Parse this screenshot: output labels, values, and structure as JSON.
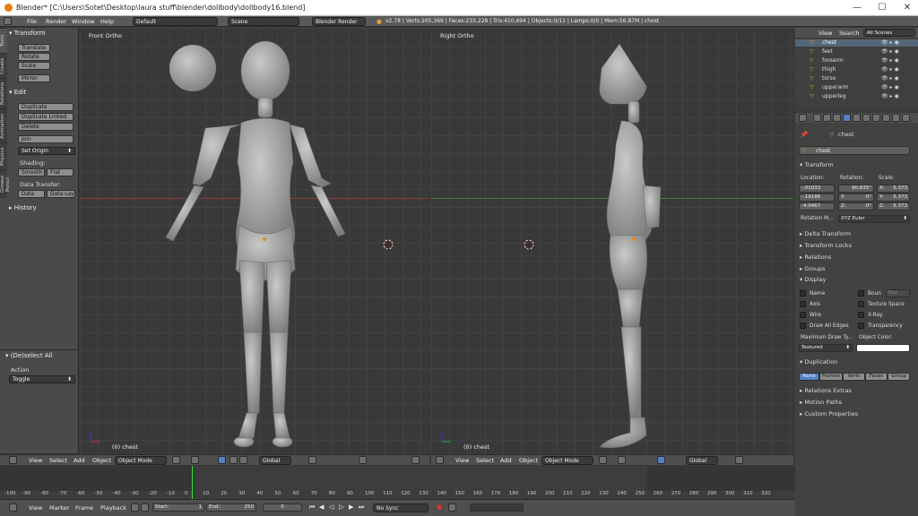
{
  "titlebar": {
    "title": "Blender* [C:\\Users\\Sotet\\Desktop\\laura stuff\\blender\\dollbody\\dollbody16.blend]",
    "min": "—",
    "max": "☐",
    "close": "✕"
  },
  "info": {
    "menus": [
      "File",
      "Render",
      "Window",
      "Help"
    ],
    "layout": "Default",
    "scene": "Scene",
    "engine": "Blender Render",
    "stats": "v2.78 | Verts:205,369 | Faces:233,228 | Tris:410,694 | Objects:0/11 | Lamps:0/0 | Mem:56.87M | chest"
  },
  "toolshelf": {
    "tabs": [
      "Tools",
      "Create",
      "Relations",
      "Animation",
      "Physics",
      "Grease Pencil"
    ],
    "transform_header": "Transform",
    "transform_buttons": [
      "Translate",
      "Rotate",
      "Scale",
      "Mirror"
    ],
    "edit_header": "Edit",
    "edit_buttons": [
      "Duplicate",
      "Duplicate Linked",
      "Delete",
      "Join"
    ],
    "set_origin": "Set Origin",
    "shading_label": "Shading:",
    "smooth": "Smooth",
    "flat": "Flat",
    "data_transfer_label": "Data Transfer:",
    "data": "Data",
    "data_layout": "Data Layo",
    "history": "History",
    "operator_header": "(De)select All",
    "action_label": "Action",
    "action_value": "Toggle"
  },
  "viewports": {
    "left": {
      "label": "Front Ortho",
      "object": "(0) chest"
    },
    "right": {
      "label": "Right Ortho",
      "object": "(0) chest"
    },
    "header": {
      "view": "View",
      "select": "Select",
      "add": "Add",
      "object": "Object",
      "mode": "Object Mode",
      "orientation": "Global"
    }
  },
  "outliner": {
    "view": "View",
    "search": "Search",
    "scenes": "All Scenes",
    "items": [
      "chest",
      "feet",
      "forearm",
      "thigh",
      "torso",
      "upperarm",
      "upperleg"
    ]
  },
  "properties": {
    "object_name": "chest",
    "breadcrumb": "chest",
    "transform": "Transform",
    "location_label": "Location:",
    "rotation_label": "Rotation:",
    "scale_label": "Scale:",
    "location": [
      "-.01033",
      "-.19186",
      "-4.0467"
    ],
    "rotation": [
      "90.835°",
      "0°",
      "0°"
    ],
    "rotation_axes": [
      "X:",
      "Y:",
      "Z:"
    ],
    "scale": [
      "5.373",
      "5.373",
      "5.373"
    ],
    "scale_axes": [
      "X:",
      "Y:",
      "Z:"
    ],
    "rotation_mode_label": "Rotation M...",
    "rotation_mode": "XYZ Euler",
    "sections": [
      "Delta Transform",
      "Transform Locks",
      "Relations",
      "Groups"
    ],
    "display": "Display",
    "checks_left": [
      "Name",
      "Axis",
      "Wire",
      "Draw All Edges"
    ],
    "checks_right": [
      "Boun",
      "Texture Space",
      "X-Ray",
      "Transparency"
    ],
    "bounds_value": "Box",
    "max_draw_label": "Maximum Draw Ty...",
    "object_color_label": "Object Color:",
    "max_draw_value": "Textured",
    "duplication": "Duplication",
    "dup_buttons": [
      "None",
      "Frames",
      "Verts",
      "Faces",
      "Group"
    ],
    "more_sections": [
      "Relations Extras",
      "Motion Paths",
      "Custom Properties"
    ]
  },
  "timeline": {
    "ticks": [
      "-100",
      "-90",
      "-80",
      "-70",
      "-60",
      "-50",
      "-40",
      "-30",
      "-20",
      "-10",
      "0",
      "10",
      "20",
      "30",
      "40",
      "50",
      "60",
      "70",
      "80",
      "90",
      "100",
      "110",
      "120",
      "130",
      "140",
      "150",
      "160",
      "170",
      "180",
      "190",
      "200",
      "210",
      "220",
      "230",
      "240",
      "250",
      "260",
      "270",
      "280",
      "290",
      "300",
      "310",
      "320"
    ],
    "menus": [
      "View",
      "Marker",
      "Frame",
      "Playback"
    ],
    "start": "Start:",
    "start_val": "1",
    "end": "End:",
    "end_val": "250",
    "current": "0",
    "sync": "No Sync"
  },
  "colors": {
    "accent": "#5680c2",
    "frame_cursor": "#33dd33",
    "outline_select": "#e88a10"
  }
}
